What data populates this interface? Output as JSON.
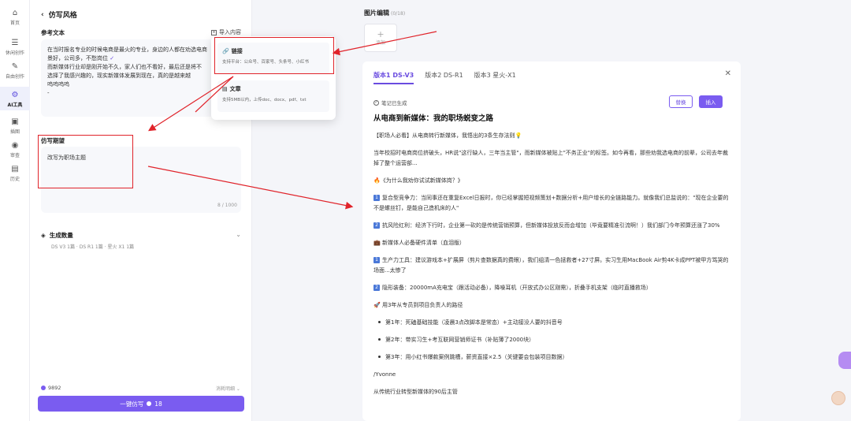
{
  "rail": {
    "items": [
      {
        "label": "首页",
        "icon": "home-icon",
        "glyph": "⌂"
      },
      {
        "label": "休闲创作",
        "icon": "document-icon",
        "glyph": "☰"
      },
      {
        "label": "自由创作",
        "icon": "pen-icon",
        "glyph": "✎"
      },
      {
        "label": "AI工具",
        "icon": "ai-tool-icon",
        "glyph": "⚙"
      },
      {
        "label": "插图",
        "icon": "image-icon",
        "glyph": "▣"
      },
      {
        "label": "审查",
        "icon": "review-icon",
        "glyph": "◉"
      },
      {
        "label": "历史",
        "icon": "history-icon",
        "glyph": "▤"
      }
    ],
    "active_index": 3
  },
  "form": {
    "title": "仿写风格",
    "reference_label": "参考文本",
    "import_label": "导入内容",
    "reference_lines": [
      "在当时报名专业的时候电商是最火的专业，身边的人都在劝选电商",
      "景好，公司多，不愁岗位",
      "而新媒体行业却是刚开始不久，家人们也不看好，最后还是将不",
      "选择了我感兴趣的，现实新媒体发展到现在，真的是越来越",
      "呜呜呜呜",
      "-"
    ],
    "hope_label": "仿写期望",
    "hope_value": "改写为职场主题",
    "hope_counter": "8 / 1000",
    "gen_label": "生成数量",
    "gen_detail": "DS V3 1篇 · DS R1 1篇 · 星火 X1 1篇",
    "credits": "9892",
    "credits_detail": "消耗明细",
    "submit_label": "一键仿写",
    "submit_cost": "18"
  },
  "popover": {
    "link_title": "链接",
    "link_desc": "支持平台：公众号、百家号、头条号、小红书",
    "doc_title": "文章",
    "doc_desc": "支持5MB以内，上传doc、docx、pdf、txt"
  },
  "editor": {
    "image_title": "图片编辑",
    "image_count": "(0/18)",
    "add_label": "添加",
    "tabs": [
      "版本1 DS-V3",
      "版本2 DS-R1",
      "版本3 星火-X1"
    ],
    "active_tab": 0,
    "status": "笔记已生成",
    "replace_label": "替换",
    "insert_label": "插入",
    "headline": "从电商到新媒体：我的职场蜕变之路",
    "p1": "【职场人必看】从电商转行新媒体，我悟出的3条生存法则💡",
    "p2": "当年校招时电商岗位挤破头，HR说\"这行缺人，三年当主管\"，而新媒体被贴上\"不务正业\"的标签。如今再看，那些劝我选电商的前辈，公司去年裁掉了整个运营部...",
    "p3": "🔥《为什么我劝你试试新媒体岗？》",
    "p4_num": "1",
    "p4": "复合型竞争力：当同事还在重复Excel日报时，你已经掌握短视频策划+数据分析+用户增长的全链路能力。就像我们总监说的：\"现在企业要的不是螺丝钉，是能自己造机床的人\"",
    "p5_num": "2",
    "p5": "抗风险红利：经济下行时，企业第一砍的是传统营销预算，但新媒体投放反而会增加（毕竟要精准引流啊！）我们部门今年预算还涨了30%",
    "p6": "💼 新媒体人必备硬件清单（血泪版）",
    "p7_num": "1",
    "p7": "生产力工具：建议游戏本+扩展屏（剪片查数据真的费眼），我们组清一色拯救者+27寸屏。实习生用MacBook Air剪4K卡成PPT被甲方骂哭的场面...太惨了",
    "p8_num": "2",
    "p8": "隐形装备：20000mA充电宝（跟活动必备），降噪耳机（开放式办公区刚需），折叠手机支架（临时直播救场）",
    "p9": "🚀 用3年从专员到项目负责人的路径",
    "b1": "第1年：死磕基础技能（凌晨3点改脚本是常态）+主动接没人要的抖音号",
    "b2": "第2年：带实习生+考互联网营销师证书（补贴薄了2000块）",
    "b3": "第3年：用小红书爆款案例跳槽，薪资直接×2.5（关键要会包装项目数据）",
    "sig1": "/Yvonne",
    "sig2": "从传统行业转型新媒体的90后主管"
  },
  "colors": {
    "accent": "#7a5cf0",
    "annotation_red": "#e0232a"
  }
}
